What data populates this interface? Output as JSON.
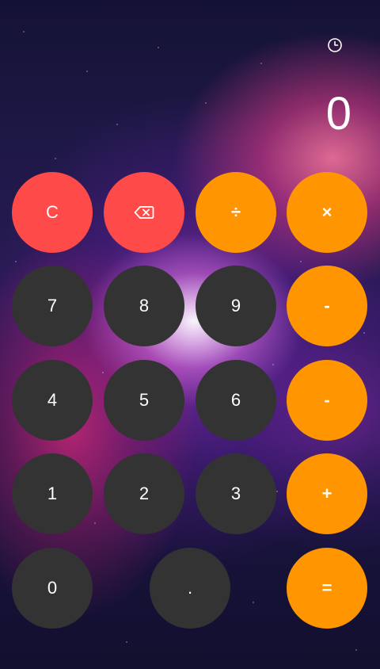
{
  "display": {
    "value": "0"
  },
  "history": {
    "icon": "clock-icon"
  },
  "keys": {
    "clear": "C",
    "backspace_icon": "backspace-icon",
    "divide": "÷",
    "multiply": "×",
    "seven": "7",
    "eight": "8",
    "nine": "9",
    "minus": "-",
    "four": "4",
    "five": "5",
    "six": "6",
    "minus_2": "-",
    "one": "1",
    "two": "2",
    "three": "3",
    "plus": "+",
    "zero": "0",
    "decimal": ".",
    "equals": "="
  },
  "colors": {
    "number_key": "#333333",
    "function_key": "#fe4a48",
    "operator_key": "#ff9500",
    "text": "#ffffff"
  }
}
